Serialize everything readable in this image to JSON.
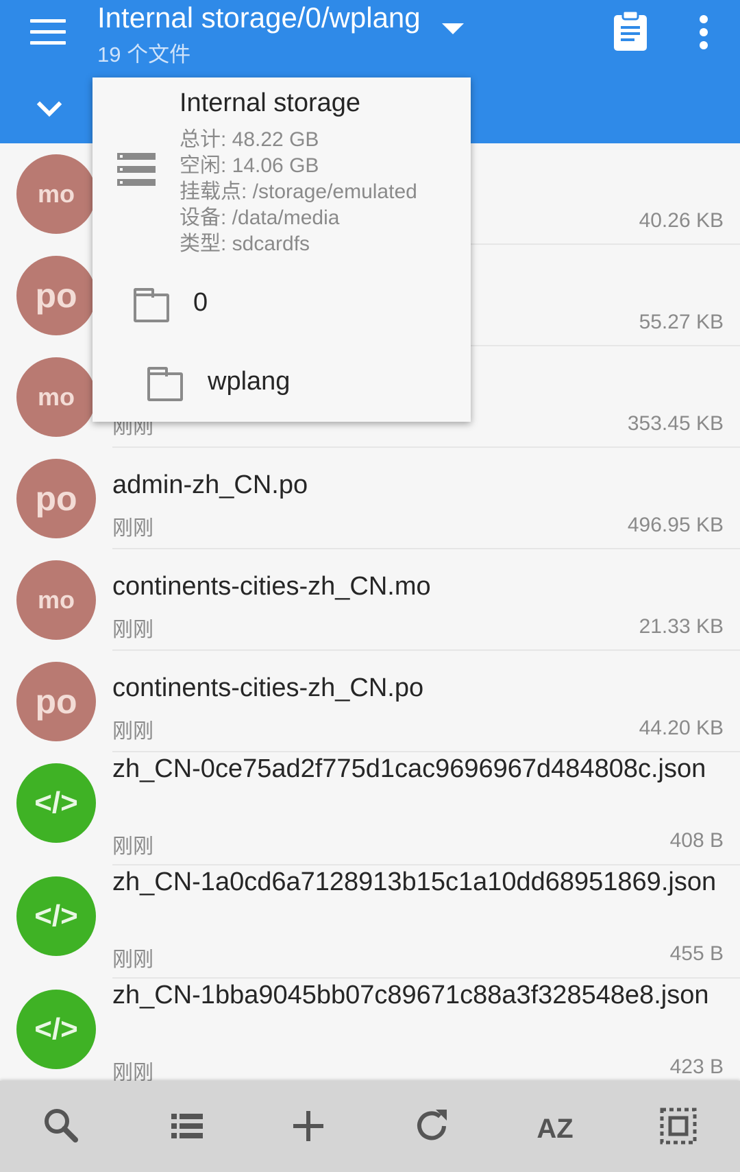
{
  "header": {
    "title": "Internal storage/0/wplang",
    "subtitle": "19 个文件"
  },
  "popup": {
    "storage": {
      "title": "Internal storage",
      "total": "总计: 48.22 GB",
      "free": "空闲: 14.06 GB",
      "mount": "挂载点: /storage/emulated",
      "device": "设备: /data/media",
      "type": "类型: sdcardfs"
    },
    "folders": [
      {
        "label": "0"
      },
      {
        "label": "wplang"
      }
    ]
  },
  "files": [
    {
      "name": "",
      "date": "",
      "size": "40.26 KB",
      "icon": "mo"
    },
    {
      "name": "",
      "date": "",
      "size": "55.27 KB",
      "icon": "po"
    },
    {
      "name": "",
      "date": "刚刚",
      "size": "353.45 KB",
      "icon": "mo"
    },
    {
      "name": "admin-zh_CN.po",
      "date": "刚刚",
      "size": "496.95 KB",
      "icon": "po"
    },
    {
      "name": "continents-cities-zh_CN.mo",
      "date": "刚刚",
      "size": "21.33 KB",
      "icon": "mo"
    },
    {
      "name": "continents-cities-zh_CN.po",
      "date": "刚刚",
      "size": "44.20 KB",
      "icon": "po"
    },
    {
      "name": "zh_CN-0ce75ad2f775d1cac9696967d484808c.json",
      "date": "刚刚",
      "size": "408 B",
      "icon": "</>"
    },
    {
      "name": "zh_CN-1a0cd6a7128913b15c1a10dd68951869.json",
      "date": "刚刚",
      "size": "455 B",
      "icon": "</>"
    },
    {
      "name": "zh_CN-1bba9045bb07c89671c88a3f328548e8.json",
      "date": "刚刚",
      "size": "423 B",
      "icon": "</>"
    }
  ],
  "toolbar": {
    "sort_label": "AZ",
    "icons": [
      "search-icon",
      "list-view-icon",
      "add-icon",
      "refresh-icon",
      "sort-az-icon",
      "select-all-icon"
    ]
  },
  "colors": {
    "appbar": "#2f8ae8",
    "mo_po_avatar": "#b97a72",
    "code_avatar": "#3fb225",
    "bottombar": "#d5d5d5"
  }
}
